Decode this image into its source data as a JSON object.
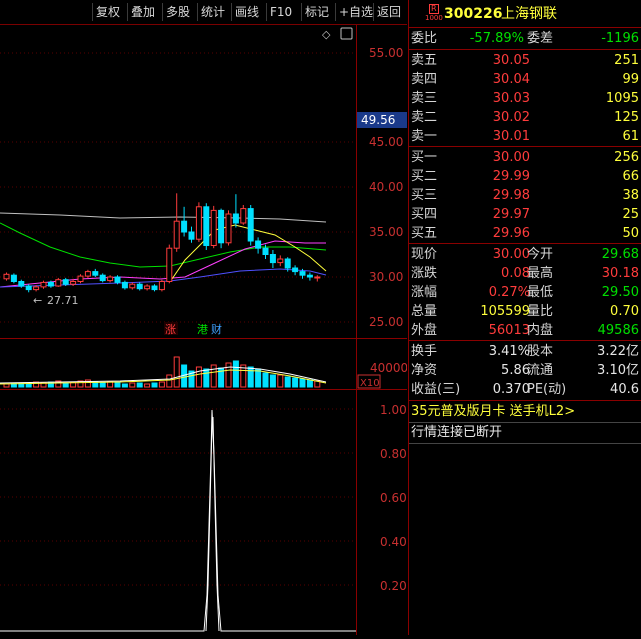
{
  "toolbar": {
    "buttons": [
      "复权",
      "叠加",
      "多股",
      "统计",
      "画线",
      "F10",
      "标记",
      "+自选",
      "返回"
    ]
  },
  "chart": {
    "price_axis": [
      "55.00",
      "45.00",
      "40.00",
      "35.00",
      "30.00",
      "25.00"
    ],
    "price_highlight": "49.56",
    "low_marker": "27.71",
    "tags": {
      "zhang": "涨",
      "gang": "港",
      "cai": "财"
    },
    "volume_axis": "40000",
    "volume_unit": "X10",
    "indicator_axis": [
      "1.00",
      "0.80",
      "0.60",
      "0.40",
      "0.20"
    ],
    "colors": {
      "up": "#ff3c3c",
      "down": "#00e0ff",
      "ma1": "#ffffff",
      "ma2": "#ffff3c",
      "ma3": "#ff40ff",
      "ma4": "#00e000"
    }
  },
  "stock": {
    "badge_top": "R",
    "badge_bottom": "1000",
    "code": "300226",
    "name": "上海钢联"
  },
  "orderbook": {
    "weibi_label": "委比",
    "weibi_value": "-57.89%",
    "weicha_label": "委差",
    "weicha_value": "-1196",
    "asks": [
      {
        "label": "卖五",
        "price": "30.05",
        "vol": "251"
      },
      {
        "label": "卖四",
        "price": "30.04",
        "vol": "99"
      },
      {
        "label": "卖三",
        "price": "30.03",
        "vol": "1095"
      },
      {
        "label": "卖二",
        "price": "30.02",
        "vol": "125"
      },
      {
        "label": "卖一",
        "price": "30.01",
        "vol": "61"
      }
    ],
    "bids": [
      {
        "label": "买一",
        "price": "30.00",
        "vol": "256"
      },
      {
        "label": "买二",
        "price": "29.99",
        "vol": "66"
      },
      {
        "label": "买三",
        "price": "29.98",
        "vol": "38"
      },
      {
        "label": "买四",
        "price": "29.97",
        "vol": "25"
      },
      {
        "label": "买五",
        "price": "29.96",
        "vol": "50"
      }
    ]
  },
  "quote": {
    "rows": [
      {
        "l1": "现价",
        "v1": "30.00",
        "l2": "今开",
        "v2": "29.68"
      },
      {
        "l1": "涨跌",
        "v1": "0.08",
        "l2": "最高",
        "v2": "30.18"
      },
      {
        "l1": "涨幅",
        "v1": "0.27%",
        "l2": "最低",
        "v2": "29.50"
      },
      {
        "l1": "总量",
        "v1": "105599",
        "l2": "量比",
        "v2": "0.70"
      },
      {
        "l1": "外盘",
        "v1": "56013",
        "l2": "内盘",
        "v2": "49586"
      }
    ]
  },
  "finance": {
    "rows": [
      {
        "l1": "换手",
        "v1": "3.41%",
        "l2": "股本",
        "v2": "3.22亿"
      },
      {
        "l1": "净资",
        "v1": "5.86",
        "l2": "流通",
        "v2": "3.10亿"
      },
      {
        "l1": "收益(三)",
        "v1": "0.370",
        "l2": "PE(动)",
        "v2": "40.6"
      }
    ]
  },
  "promo": "35元普及版月卡 送手机L2>",
  "status": "行情连接已断开"
}
